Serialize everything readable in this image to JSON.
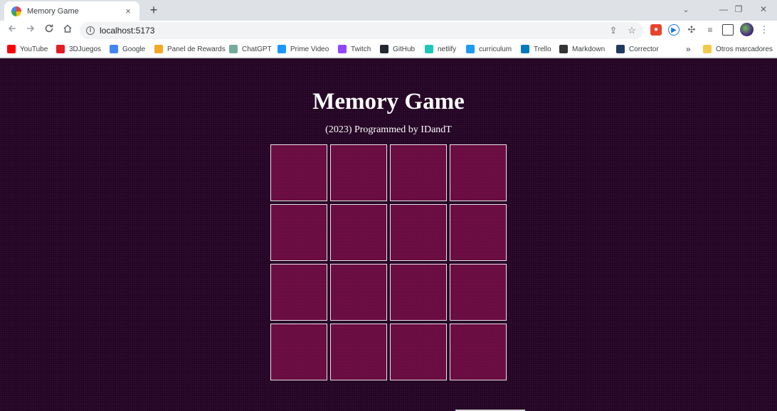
{
  "browser": {
    "tab_title": "Memory Game",
    "tab_close": "×",
    "new_tab": "+",
    "url": "localhost:5173",
    "window_controls": {
      "search_tabs": "⌄",
      "minimize": "—",
      "restore": "❐",
      "close": "✕"
    }
  },
  "bookmarks": [
    {
      "label": "YouTube",
      "icon": "youtube-icon",
      "color": "#ff0000"
    },
    {
      "label": "3DJuegos",
      "icon": "3djuegos-icon",
      "color": "#e31b23"
    },
    {
      "label": "Google",
      "icon": "google-icon",
      "color": "#4285f4"
    },
    {
      "label": "Panel de Rewards",
      "icon": "rewards-icon",
      "color": "#f5a623"
    },
    {
      "label": "ChatGPT",
      "icon": "chatgpt-icon",
      "color": "#74aa9c"
    },
    {
      "label": "Prime Video",
      "icon": "prime-video-icon",
      "color": "#1a98ff"
    },
    {
      "label": "Twitch",
      "icon": "twitch-icon",
      "color": "#9146ff"
    },
    {
      "label": "GitHub",
      "icon": "github-icon",
      "color": "#24292f"
    },
    {
      "label": "netlify",
      "icon": "netlify-icon",
      "color": "#20c6b7"
    },
    {
      "label": "curriculum",
      "icon": "twitter-icon",
      "color": "#1d9bf0"
    },
    {
      "label": "Trello",
      "icon": "trello-icon",
      "color": "#0079bf"
    },
    {
      "label": "Markdown",
      "icon": "markdown-icon",
      "color": "#333333"
    },
    {
      "label": "Corrector",
      "icon": "corrector-icon",
      "color": "#1f3a5f"
    }
  ],
  "bookmarks_overflow": "»",
  "other_bookmarks": "Otros marcadores",
  "page": {
    "title": "Memory Game",
    "subtitle": "(2023) Programmed by IDandT",
    "background_color": "#240424",
    "card_color": "#7a0f4c",
    "grid": {
      "rows": 4,
      "columns": 4
    }
  }
}
